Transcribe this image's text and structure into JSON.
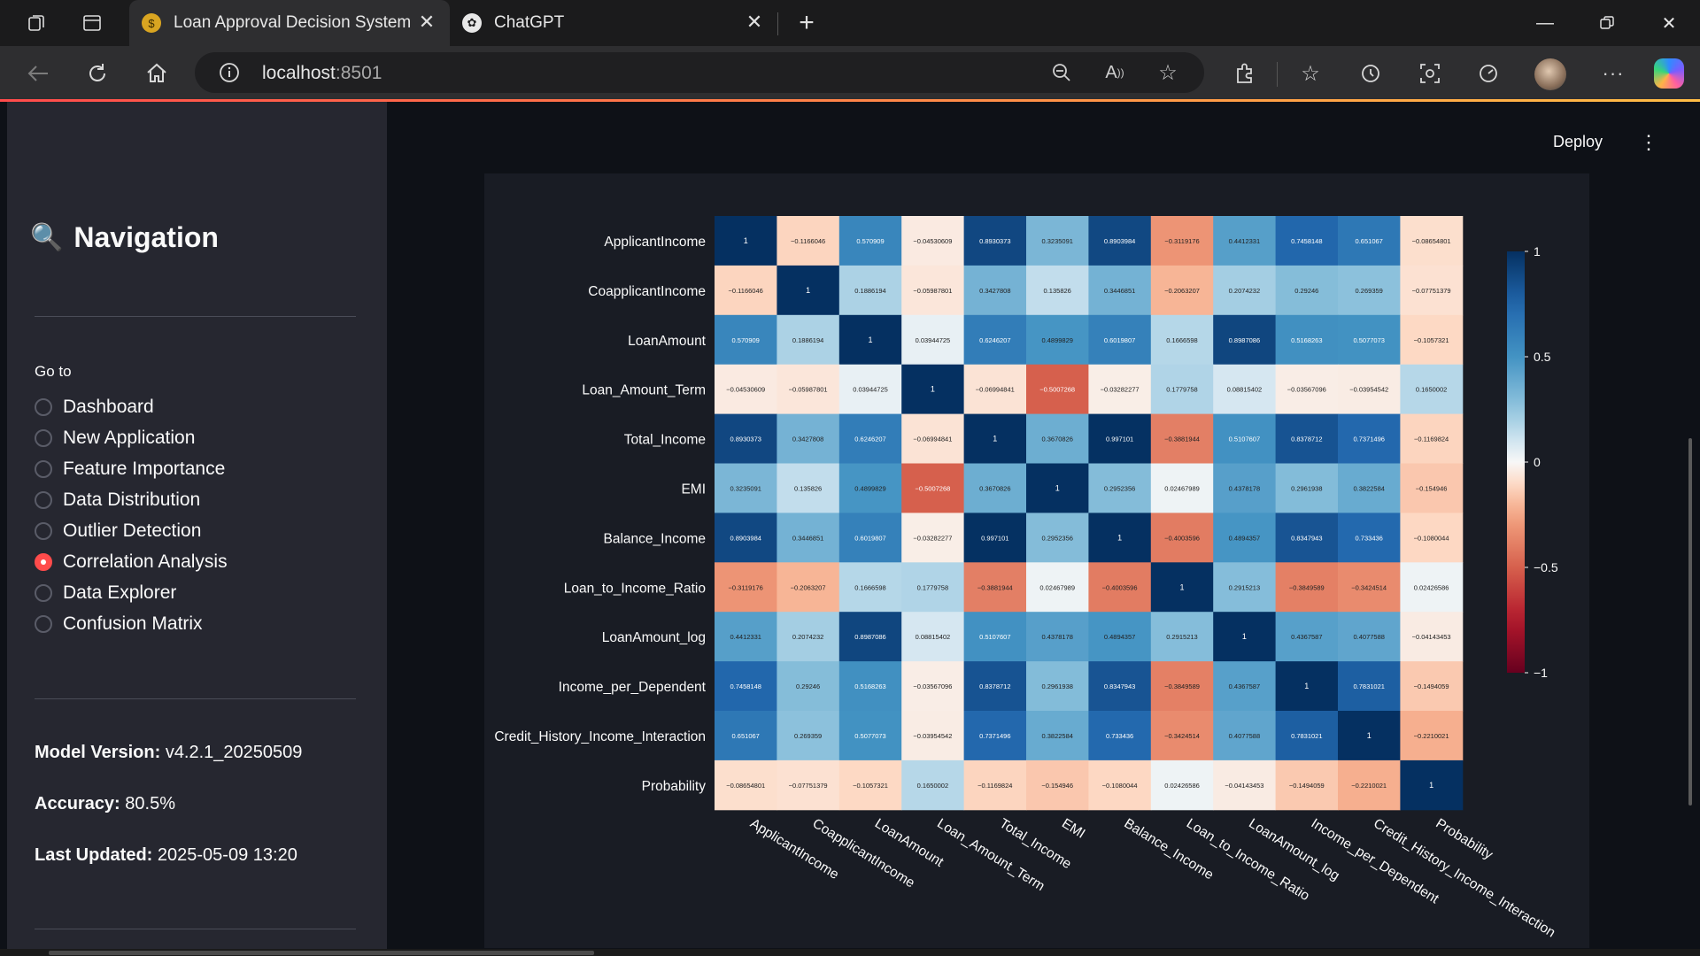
{
  "browser": {
    "tabs": [
      {
        "title": "Loan Approval Decision System",
        "favicon": "money-bag-icon",
        "active": true
      },
      {
        "title": "ChatGPT",
        "favicon": "openai-icon",
        "active": false
      }
    ],
    "url_host": "localhost",
    "url_port": ":8501"
  },
  "app": {
    "deploy_label": "Deploy",
    "sidebar": {
      "title": "Navigation",
      "title_icon": "magnifier-icon",
      "goto_label": "Go to",
      "options": [
        {
          "label": "Dashboard",
          "selected": false
        },
        {
          "label": "New Application",
          "selected": false
        },
        {
          "label": "Feature Importance",
          "selected": false
        },
        {
          "label": "Data Distribution",
          "selected": false
        },
        {
          "label": "Outlier Detection",
          "selected": false
        },
        {
          "label": "Correlation Analysis",
          "selected": true
        },
        {
          "label": "Data Explorer",
          "selected": false
        },
        {
          "label": "Confusion Matrix",
          "selected": false
        }
      ],
      "model_version_label": "Model Version:",
      "model_version_value": "v4.2.1_20250509",
      "accuracy_label": "Accuracy:",
      "accuracy_value": "80.5%",
      "last_updated_label": "Last Updated:",
      "last_updated_value": "2025-05-09 13:20"
    },
    "colors": {
      "accent": "#ff4b4b",
      "sidebar_bg": "#262730",
      "main_bg": "#0e1117",
      "figure_bg": "#191c24"
    }
  },
  "chart_data": {
    "type": "heatmap",
    "colormap": "RdBu",
    "vmin": -1,
    "vmax": 1,
    "colorbar_ticks": [
      "1",
      "0.5",
      "0",
      "−0.5",
      "−1"
    ],
    "colorbar_values": [
      1,
      0.5,
      0,
      -0.5,
      -1
    ],
    "labels": [
      "ApplicantIncome",
      "CoapplicantIncome",
      "LoanAmount",
      "Loan_Amount_Term",
      "Total_Income",
      "EMI",
      "Balance_Income",
      "Loan_to_Income_Ratio",
      "LoanAmount_log",
      "Income_per_Dependent",
      "Credit_History_Income_Interaction",
      "Probability"
    ],
    "values": [
      [
        1,
        -0.1166046,
        0.570909,
        -0.04530609,
        0.8930373,
        0.3235091,
        0.8903984,
        -0.3119176,
        0.4412331,
        0.7458148,
        0.651067,
        -0.08654801
      ],
      [
        -0.1166046,
        1,
        0.1886194,
        -0.05987801,
        0.3427808,
        0.135826,
        0.3446851,
        -0.2063207,
        0.2074232,
        0.29246,
        0.269359,
        -0.07751379
      ],
      [
        0.570909,
        0.1886194,
        1,
        0.03944725,
        0.6246207,
        0.4899829,
        0.6019807,
        0.1666598,
        0.8987086,
        0.5168263,
        0.5077073,
        -0.1057321
      ],
      [
        -0.04530609,
        -0.05987801,
        0.03944725,
        1,
        -0.06994841,
        -0.5007268,
        -0.03282277,
        0.1779758,
        0.08815402,
        -0.03567096,
        -0.03954542,
        0.1650002
      ],
      [
        0.8930373,
        0.3427808,
        0.6246207,
        -0.06994841,
        1,
        0.3670826,
        0.997101,
        -0.3881944,
        0.5107607,
        0.8378712,
        0.7371496,
        -0.1169824
      ],
      [
        0.3235091,
        0.135826,
        0.4899829,
        -0.5007268,
        0.3670826,
        1,
        0.2952356,
        0.02467989,
        0.4378178,
        0.2961938,
        0.3822584,
        -0.154946
      ],
      [
        0.8903984,
        0.3446851,
        0.6019807,
        -0.03282277,
        0.997101,
        0.2952356,
        1,
        -0.4003596,
        0.4894357,
        0.8347943,
        0.733436,
        -0.1080044
      ],
      [
        -0.3119176,
        -0.2063207,
        0.1666598,
        0.1779758,
        -0.3881944,
        0.02467989,
        -0.4003596,
        1,
        0.2915213,
        -0.3849589,
        -0.3424514,
        0.02426586
      ],
      [
        0.4412331,
        0.2074232,
        0.8987086,
        0.08815402,
        0.5107607,
        0.4378178,
        0.4894357,
        0.2915213,
        1,
        0.4367587,
        0.4077588,
        -0.04143453
      ],
      [
        0.7458148,
        0.29246,
        0.5168263,
        -0.03567096,
        0.8378712,
        0.2961938,
        0.8347943,
        -0.3849589,
        0.4367587,
        1,
        0.7831021,
        -0.1494059
      ],
      [
        0.651067,
        0.269359,
        0.5077073,
        -0.03954542,
        0.7371496,
        0.3822584,
        0.733436,
        -0.3424514,
        0.4077588,
        0.7831021,
        1,
        -0.2210021
      ],
      [
        -0.08654801,
        -0.07751379,
        -0.1057321,
        0.1650002,
        -0.1169824,
        -0.154946,
        -0.1080044,
        0.02426586,
        -0.04143453,
        -0.1494059,
        -0.2210021,
        1
      ]
    ]
  }
}
